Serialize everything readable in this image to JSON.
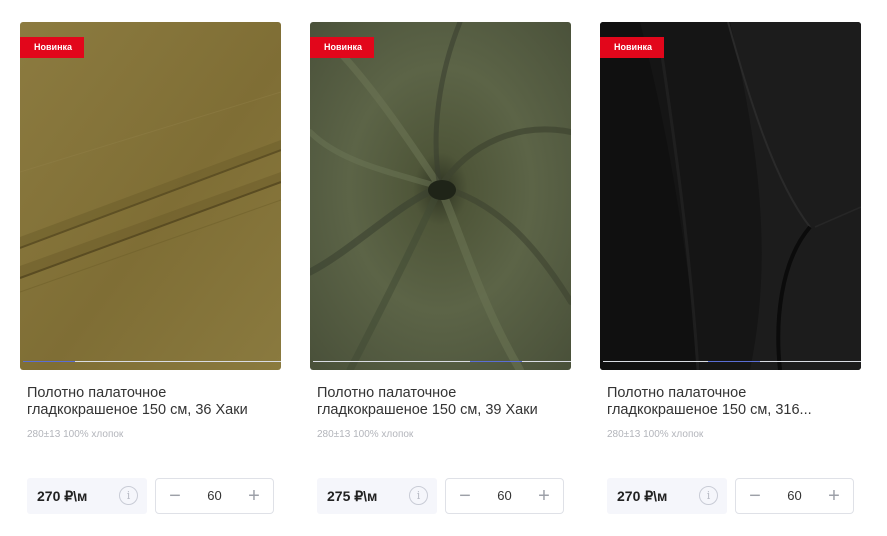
{
  "products": [
    {
      "badge": "Новинка",
      "title_line1": "Полотно палаточное",
      "title_line2": "гладкокрашеное 150 см, 36 Хаки",
      "spec": "280±13 100% хлопок",
      "price": "270 ₽\\м",
      "quantity": "60",
      "minus": "−",
      "plus": "+",
      "fabric_color": "#86753b",
      "slider_active_index": 0
    },
    {
      "badge": "Новинка",
      "title_line1": "Полотно палаточное",
      "title_line2": "гладкокрашеное 150 см, 39 Хаки",
      "spec": "280±13 100% хлопок",
      "price": "275 ₽\\м",
      "quantity": "60",
      "minus": "−",
      "plus": "+",
      "fabric_color": "#555c40",
      "slider_active_index": 2
    },
    {
      "badge": "Новинка",
      "title_line1": "Полотно палаточное",
      "title_line2": "гладкокрашеное 150 см, 316...",
      "spec": "280±13 100% хлопок",
      "price": "270 ₽\\м",
      "quantity": "60",
      "minus": "−",
      "plus": "+",
      "fabric_color": "#141414",
      "slider_active_index": 2
    }
  ],
  "colors": {
    "badge": "#e2061b",
    "slider_active": "#5a6ed4"
  },
  "icons": {
    "info": "info-icon",
    "minus": "minus-icon",
    "plus": "plus-icon"
  }
}
